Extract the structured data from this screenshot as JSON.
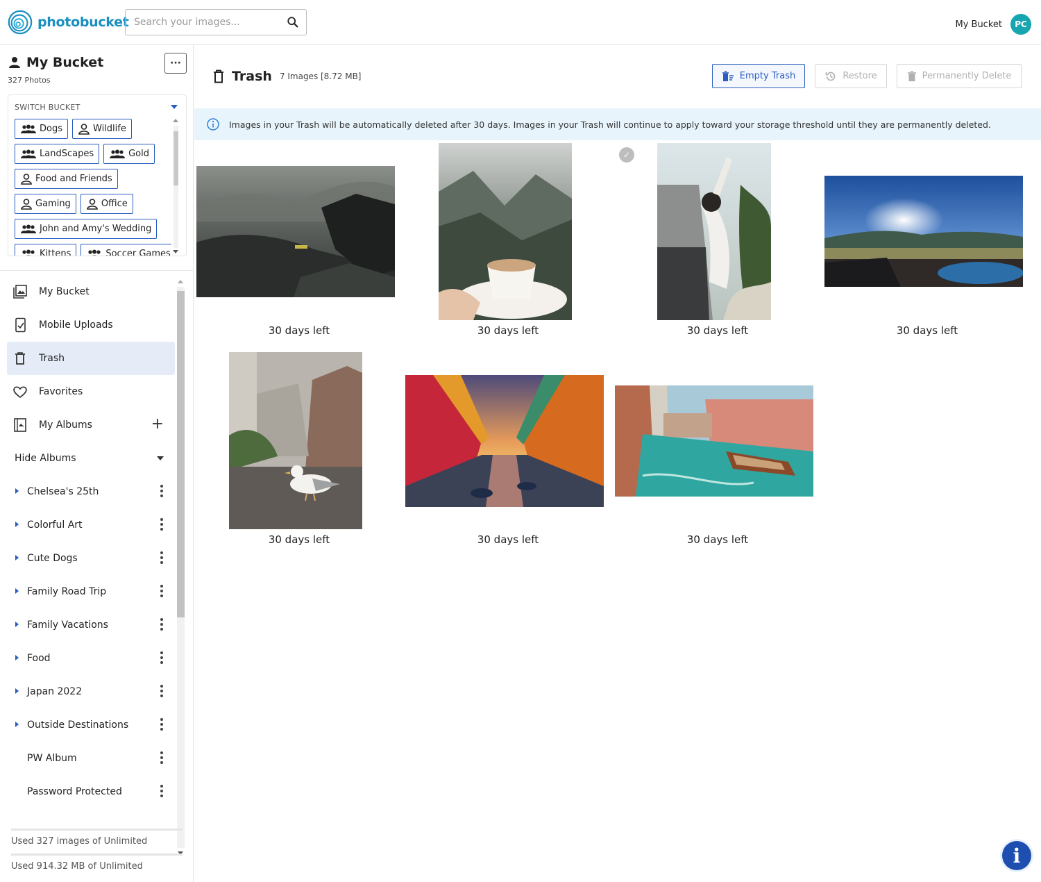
{
  "brand": {
    "name": "photobucket",
    "color": "#1a8fc1"
  },
  "search": {
    "placeholder": "Search your images..."
  },
  "header": {
    "bucket_name": "My Bucket",
    "avatar_initials": "PC"
  },
  "sidebar": {
    "title": "My Bucket",
    "photo_count": "327 Photos",
    "switch_bucket": {
      "heading": "SWITCH BUCKET",
      "rows": [
        [
          {
            "label": "Dogs",
            "icon": "group-icon"
          },
          {
            "label": "Wildlife",
            "icon": "person-icon"
          }
        ],
        [
          {
            "label": "LandScapes",
            "icon": "group-icon"
          },
          {
            "label": "Gold",
            "icon": "group-icon"
          }
        ],
        [
          {
            "label": "Food and Friends",
            "icon": "person-icon"
          }
        ],
        [
          {
            "label": "Gaming",
            "icon": "person-icon"
          },
          {
            "label": "Office",
            "icon": "person-icon"
          }
        ],
        [
          {
            "label": "John and Amy's Wedding",
            "icon": "group-icon"
          }
        ],
        [
          {
            "label": "Kittens",
            "icon": "group-icon"
          },
          {
            "label": "Soccer Games",
            "icon": "group-icon"
          }
        ]
      ]
    },
    "nav": [
      {
        "label": "My Bucket",
        "icon": "photo-library-icon"
      },
      {
        "label": "Mobile Uploads",
        "icon": "mobile-upload-icon"
      },
      {
        "label": "Trash",
        "icon": "trash-icon",
        "active": true
      },
      {
        "label": "Favorites",
        "icon": "heart-icon"
      },
      {
        "label": "My Albums",
        "icon": "album-icon"
      }
    ],
    "hide_albums": "Hide Albums",
    "albums": [
      {
        "label": "Chelsea's 25th",
        "expandable": true
      },
      {
        "label": "Colorful Art",
        "expandable": true
      },
      {
        "label": "Cute Dogs",
        "expandable": true
      },
      {
        "label": "Family Road Trip",
        "expandable": true
      },
      {
        "label": "Family Vacations",
        "expandable": true
      },
      {
        "label": "Food",
        "expandable": true
      },
      {
        "label": "Japan 2022",
        "expandable": true
      },
      {
        "label": "Outside Destinations",
        "expandable": true
      },
      {
        "label": "PW Album",
        "expandable": false
      },
      {
        "label": "Password Protected",
        "expandable": false
      }
    ],
    "usage_images": "Used 327 images of Unlimited",
    "usage_storage": "Used 914.32 MB of Unlimited"
  },
  "main": {
    "title": "Trash",
    "count": "7 Images [8.72 MB]",
    "actions": {
      "empty": "Empty Trash",
      "restore": "Restore",
      "delete": "Permanently Delete"
    },
    "banner": "Images in your Trash will be automatically deleted after 30 days. Images in your Trash will continue to apply toward your storage threshold until they are permanently deleted.",
    "photos": [
      {
        "subject": "misty-rocky-landscape",
        "days_left": "30 days left"
      },
      {
        "subject": "coffee-cup-mountains",
        "days_left": "30 days left"
      },
      {
        "subject": "person-waving-from-car",
        "days_left": "30 days left"
      },
      {
        "subject": "sunny-lake-resort",
        "days_left": "30 days left"
      },
      {
        "subject": "seagull-on-street",
        "days_left": "30 days left"
      },
      {
        "subject": "colorful-canal-sunset",
        "days_left": "30 days left"
      },
      {
        "subject": "venice-canal-boat",
        "days_left": "30 days left"
      }
    ]
  },
  "colors": {
    "accent": "#2a5dbf",
    "active_nav": "#e6ecf7",
    "banner": "#e8f4fb",
    "avatar": "#17a6b0"
  }
}
